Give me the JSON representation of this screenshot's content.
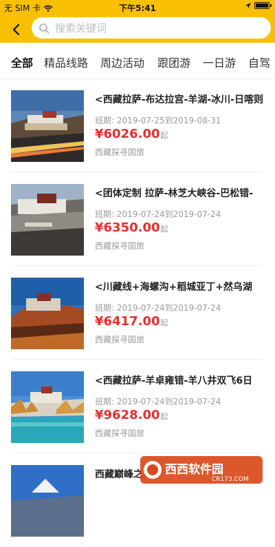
{
  "status_bar": {
    "carrier": "无 SIM 卡",
    "time": "下午5:41"
  },
  "search": {
    "placeholder": "搜索关键词"
  },
  "tabs": [
    {
      "label": "全部",
      "active": true
    },
    {
      "label": "精品线路"
    },
    {
      "label": "周边活动"
    },
    {
      "label": "跟团游"
    },
    {
      "label": "一日游"
    },
    {
      "label": "自驾"
    }
  ],
  "items": [
    {
      "title": "<西藏拉萨-布达拉宫-羊湖-冰川-日喀则",
      "period": "班期: 2019-07-25到2019-08-31",
      "price": "¥6026.00",
      "price_suffix": "起",
      "agency": "西藏探寻国旅"
    },
    {
      "title": "<团体定制 拉萨-林芝大峡谷-巴松错-",
      "period": "班期: 2019-07-24到2019-07-24",
      "price": "¥6350.00",
      "price_suffix": "起",
      "agency": "西藏探寻国旅"
    },
    {
      "title": "<川藏线+海螺沟+稻城亚丁+然乌湖",
      "period": "班期: 2019-07-24到2019-07-24",
      "price": "¥6417.00",
      "price_suffix": "起",
      "agency": "西藏探寻国旅"
    },
    {
      "title": "<西藏拉萨-羊卓雍错-羊八井双飞6日",
      "period": "班期: 2019-07-24到2019-07-24",
      "price": "¥9628.00",
      "price_suffix": "起",
      "agency": "西藏探寻国旅"
    },
    {
      "title": "西藏巅峰之旅",
      "period": "",
      "price": "",
      "price_suffix": "",
      "agency": ""
    }
  ],
  "watermark": {
    "brand": "西西软件园",
    "url": "CR173.COM"
  },
  "colors": {
    "brand_yellow": "#f8c000",
    "price_red": "#e52e2e",
    "meta_gray": "#9a9a9a"
  }
}
